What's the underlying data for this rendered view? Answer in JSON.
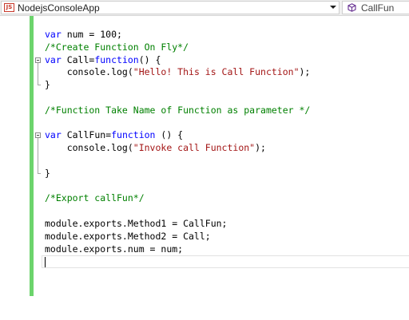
{
  "navbar": {
    "project_name": "NodejsConsoleApp",
    "js_badge": "JS",
    "member_name": "CallFun"
  },
  "editor": {
    "lines": [
      [
        [
          "kw",
          "var"
        ],
        [
          "pl",
          " num = 100;"
        ]
      ],
      [
        [
          "cm",
          "/*Create Function On Fly*/"
        ]
      ],
      [
        [
          "kw",
          "var"
        ],
        [
          "pl",
          " Call="
        ],
        [
          "kw",
          "function"
        ],
        [
          "pl",
          "() {"
        ]
      ],
      [
        [
          "pl",
          "    console.log("
        ],
        [
          "st",
          "\"Hello! This is Call Function\""
        ],
        [
          "pl",
          ");"
        ]
      ],
      [
        [
          "pl",
          "}"
        ]
      ],
      [],
      [
        [
          "cm",
          "/*Function Take Name of Function as parameter */"
        ]
      ],
      [],
      [
        [
          "kw",
          "var"
        ],
        [
          "pl",
          " CallFun="
        ],
        [
          "kw",
          "function"
        ],
        [
          "pl",
          " () {"
        ]
      ],
      [
        [
          "pl",
          "    console.log("
        ],
        [
          "st",
          "\"Invoke call Function\""
        ],
        [
          "pl",
          ");"
        ]
      ],
      [],
      [
        [
          "pl",
          "}"
        ]
      ],
      [],
      [
        [
          "cm",
          "/*Export callFun*/"
        ]
      ],
      [],
      [
        [
          "pl",
          "module.exports.Method1 = CallFun;"
        ]
      ],
      [
        [
          "pl",
          "module.exports.Method2 = Call;"
        ]
      ],
      [
        [
          "pl",
          "module.exports.num = num;"
        ]
      ],
      []
    ],
    "outline_starts": [
      2,
      8
    ],
    "outline_mids": [
      3,
      9,
      10
    ],
    "outline_ends": [
      4,
      11
    ],
    "cursor_line": 18,
    "colors": {
      "keyword": "#0000ff",
      "comment": "#008000",
      "string": "#a31515",
      "change_bar": "#6cd46c"
    }
  }
}
